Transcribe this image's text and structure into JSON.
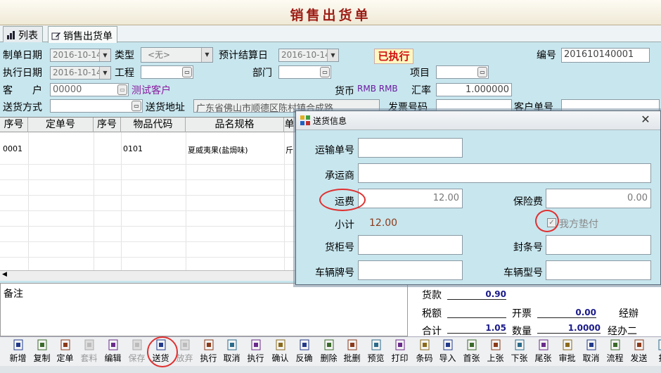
{
  "window": {
    "title": "销售出货单"
  },
  "tabs": [
    {
      "label": "列表"
    },
    {
      "label": "销售出货单"
    }
  ],
  "form": {
    "create_date": {
      "label": "制单日期",
      "value": "2016-10-14"
    },
    "type": {
      "label": "类型",
      "value": "<无>"
    },
    "est_settle_date": {
      "label": "预计结算日",
      "value": "2016-10-14"
    },
    "status": "已执行",
    "number": {
      "label": "编号",
      "value": "201610140001"
    },
    "exec_date": {
      "label": "执行日期",
      "value": "2016-10-14"
    },
    "project_eng": {
      "label": "工程",
      "value": ""
    },
    "dept": {
      "label": "部门",
      "value": ""
    },
    "item": {
      "label": "项目",
      "value": ""
    },
    "customer": {
      "label": "客　　户",
      "code": "00000",
      "name": "测试客户"
    },
    "currency": {
      "label": "货币",
      "value": "RMB RMB"
    },
    "rate": {
      "label": "汇率",
      "value": "1.000000"
    },
    "ship_method": {
      "label": "送货方式",
      "value": ""
    },
    "ship_address": {
      "label": "送货地址",
      "value": "广东省佛山市顺德区陈村镇合成路"
    },
    "invoice_no": {
      "label": "发票号码",
      "value": ""
    },
    "customer_order": {
      "label": "客户单号",
      "value": ""
    }
  },
  "grid": {
    "columns": [
      "序号",
      "定单号",
      "序号",
      "物品代码",
      "品名规格",
      "单"
    ],
    "rows": [
      {
        "seq": "0001",
        "order_no": "",
        "seq2": "",
        "code": "0101",
        "name": "夏威夷果(盐焗味)",
        "unit": "斤"
      }
    ]
  },
  "notes": {
    "label": "备注"
  },
  "totals": {
    "goods": {
      "label": "货款",
      "value": "0.90"
    },
    "tax": {
      "label": "税额",
      "value": ""
    },
    "invoice": {
      "label": "开票",
      "value": "0.00"
    },
    "handler": {
      "label": "经辦",
      "value": ""
    },
    "sum": {
      "label": "合计",
      "value": "1.05"
    },
    "qty": {
      "label": "数量",
      "value": "1.0000"
    },
    "handler2": {
      "label": "经办二",
      "value": ""
    }
  },
  "dialog": {
    "title": "送货信息",
    "transport_no": {
      "label": "运输单号",
      "value": ""
    },
    "carrier": {
      "label": "承运商",
      "value": ""
    },
    "freight": {
      "label": "运费",
      "value": "12.00"
    },
    "insurance": {
      "label": "保险费",
      "value": "0.00"
    },
    "subtotal": {
      "label": "小计",
      "value": "12.00"
    },
    "we_pay": {
      "label": "我方垫付",
      "checked": true
    },
    "container_no": {
      "label": "货柜号",
      "value": ""
    },
    "seal_no": {
      "label": "封条号",
      "value": ""
    },
    "plate_no": {
      "label": "车辆牌号",
      "value": ""
    },
    "vehicle_model": {
      "label": "车辆型号",
      "value": ""
    }
  },
  "toolbar": [
    {
      "label": "新增",
      "icon": "new-doc-icon",
      "enabled": true
    },
    {
      "label": "复制",
      "icon": "copy-icon",
      "enabled": true
    },
    {
      "label": "定单",
      "icon": "order-icon",
      "enabled": true
    },
    {
      "label": "套料",
      "icon": "material-icon",
      "enabled": false
    },
    {
      "label": "编辑",
      "icon": "edit-icon",
      "enabled": true
    },
    {
      "label": "保存",
      "icon": "save-icon",
      "enabled": false
    },
    {
      "label": "送货",
      "icon": "delivery-icon",
      "enabled": true
    },
    {
      "label": "放弃",
      "icon": "undo-icon",
      "enabled": false
    },
    {
      "label": "执行",
      "icon": "execute-icon",
      "enabled": true
    },
    {
      "label": "取消",
      "icon": "cancel-icon",
      "enabled": true
    },
    {
      "label": "执行",
      "icon": "execute2-icon",
      "enabled": true
    },
    {
      "label": "确认",
      "icon": "confirm-icon",
      "enabled": true
    },
    {
      "label": "反确",
      "icon": "unconfirm-icon",
      "enabled": true
    },
    {
      "label": "删除",
      "icon": "delete-icon",
      "enabled": true
    },
    {
      "label": "批删",
      "icon": "batch-delete-icon",
      "enabled": true
    },
    {
      "label": "预览",
      "icon": "preview-icon",
      "enabled": true
    },
    {
      "label": "打印",
      "icon": "print-icon",
      "enabled": true
    },
    {
      "label": "条码",
      "icon": "barcode-print-icon",
      "enabled": true
    },
    {
      "label": "导入",
      "icon": "import-icon",
      "enabled": true
    },
    {
      "label": "首张",
      "icon": "first-icon",
      "enabled": true
    },
    {
      "label": "上张",
      "icon": "prev-icon",
      "enabled": true
    },
    {
      "label": "下张",
      "icon": "next-icon",
      "enabled": true
    },
    {
      "label": "尾张",
      "icon": "last-icon",
      "enabled": true
    },
    {
      "label": "审批",
      "icon": "approve-icon",
      "enabled": true
    },
    {
      "label": "取消",
      "icon": "cancel-approve-icon",
      "enabled": true
    },
    {
      "label": "流程",
      "icon": "flow-icon",
      "enabled": true
    },
    {
      "label": "发送",
      "icon": "send-icon",
      "enabled": true
    },
    {
      "label": "排",
      "icon": "more-icon",
      "enabled": true
    }
  ],
  "colors": {
    "panel": "#c8e6ee",
    "status_red": "#d01010",
    "highlight_ring": "#e03030",
    "title": "#9c1c14"
  }
}
